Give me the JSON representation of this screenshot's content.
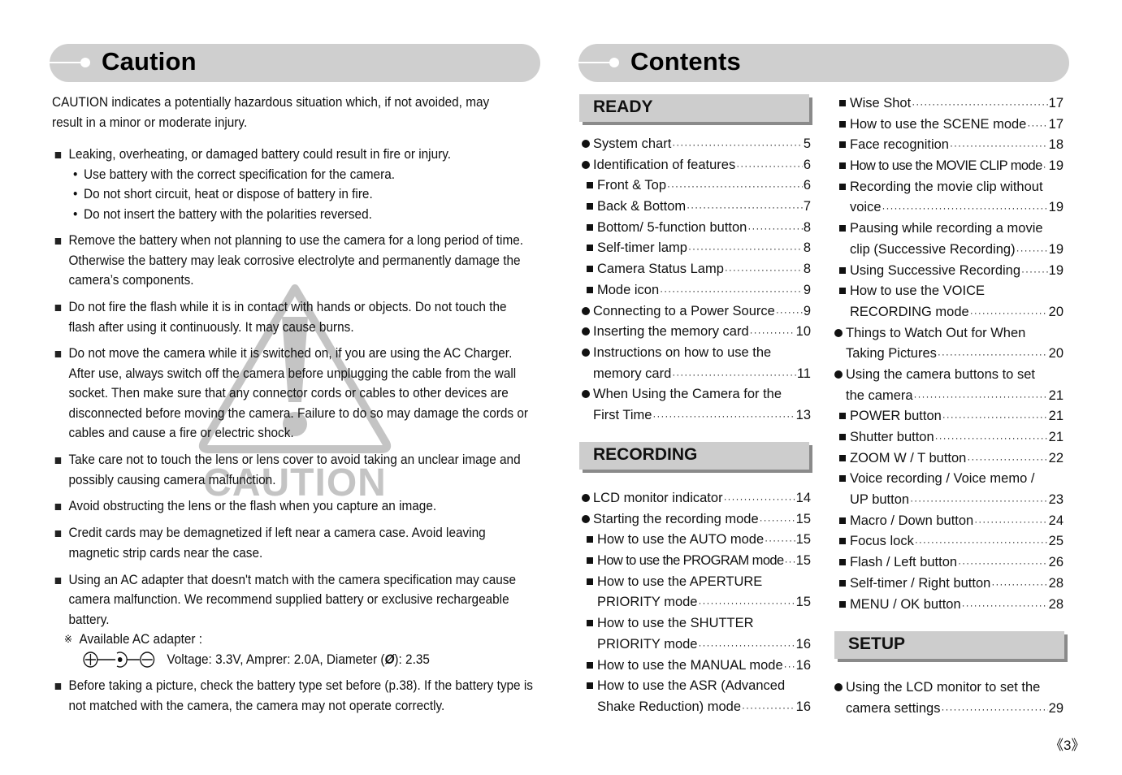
{
  "left_page": {
    "title": "Caution",
    "intro": "CAUTION indicates a potentially hazardous situation which, if not avoided, may result in a minor or moderate injury.",
    "items": [
      {
        "text": "Leaking, overheating, or damaged battery could result in fire or injury.",
        "subitems": [
          "Use battery with the correct specification for the camera.",
          "Do not short circuit, heat or dispose of battery in fire.",
          "Do not insert the battery with the polarities reversed."
        ]
      },
      {
        "text": "Remove the battery when not planning to use the camera for a long period of time. Otherwise the battery may leak corrosive electrolyte and permanently damage the camera’s components."
      },
      {
        "text": "Do not fire the flash while it is in contact with hands or objects. Do not touch the flash after using it continuously. It may cause burns."
      },
      {
        "text": "Do not move the camera while it is switched on, if you are using the AC Charger. After use, always switch off the camera before unplugging the cable from the wall socket. Then make sure that any connector cords or cables to other devices are disconnected before moving the camera. Failure to do so may damage the cords or cables and cause a fire or electric shock."
      },
      {
        "text": "Take care not to touch the lens or lens cover to avoid taking an unclear image and possibly causing camera malfunction."
      },
      {
        "text": "Avoid obstructing the lens or the flash when you capture an image."
      },
      {
        "text": "Credit cards may be demagnetized if left near a camera case. Avoid leaving magnetic strip cards near the case."
      },
      {
        "text": "Using an AC adapter that doesn't match with the camera specification may cause camera malfunction. We recommend supplied battery or exclusive rechargeable battery.",
        "note_mark": "※",
        "note": "Available AC adapter :",
        "adapter_spec": "Voltage: 3.3V, Amprer: 2.0A, Diameter (",
        "diameter_symbol": "Ø",
        "adapter_spec_end": "): 2.35"
      },
      {
        "text": "Before taking a picture, check the battery type set before (p.38). If the battery type is not matched with the camera, the camera may not operate correctly."
      }
    ],
    "watermark_text": "CAUTION",
    "watermark_icon": "warning-triangle-icon"
  },
  "right_page": {
    "title": "Contents",
    "sections": {
      "ready": {
        "label": "READY",
        "entries": [
          {
            "bullet": "circle",
            "lines": [
              "System chart"
            ],
            "page": "5"
          },
          {
            "bullet": "circle",
            "lines": [
              "Identification of features"
            ],
            "page": "6"
          },
          {
            "bullet": "square",
            "lines": [
              "Front & Top"
            ],
            "page": "6"
          },
          {
            "bullet": "square",
            "lines": [
              "Back & Bottom"
            ],
            "page": "7"
          },
          {
            "bullet": "square",
            "lines": [
              "Bottom/ 5-function button"
            ],
            "page": "8"
          },
          {
            "bullet": "square",
            "lines": [
              "Self-timer lamp"
            ],
            "page": "8"
          },
          {
            "bullet": "square",
            "lines": [
              "Camera Status Lamp"
            ],
            "page": "8"
          },
          {
            "bullet": "square",
            "lines": [
              "Mode icon"
            ],
            "page": "9"
          },
          {
            "bullet": "circle",
            "lines": [
              "Connecting to a Power Source"
            ],
            "page": "9"
          },
          {
            "bullet": "circle",
            "lines": [
              "Inserting the memory card"
            ],
            "page": "10"
          },
          {
            "bullet": "circle",
            "lines": [
              "Instructions on how to use the",
              "memory card"
            ],
            "page": "11"
          },
          {
            "bullet": "circle",
            "lines": [
              "When Using the Camera for the",
              "First Time"
            ],
            "page": "13"
          }
        ]
      },
      "recording": {
        "label": "RECORDING",
        "entries": [
          {
            "bullet": "circle",
            "lines": [
              "LCD monitor indicator"
            ],
            "page": "14"
          },
          {
            "bullet": "circle",
            "lines": [
              "Starting the recording mode"
            ],
            "page": "15"
          },
          {
            "bullet": "square",
            "lines": [
              "How to use the AUTO mode"
            ],
            "page": "15"
          },
          {
            "bullet": "square",
            "lines": [
              "How to use the PROGRAM mode"
            ],
            "page": "15"
          },
          {
            "bullet": "square",
            "lines": [
              "How to use the APERTURE",
              "PRIORITY mode"
            ],
            "page": "15"
          },
          {
            "bullet": "square",
            "lines": [
              "How to use the SHUTTER",
              "PRIORITY mode"
            ],
            "page": "16"
          },
          {
            "bullet": "square",
            "lines": [
              "How to use the MANUAL mode"
            ],
            "page": "16"
          },
          {
            "bullet": "square",
            "lines": [
              "How to use the ASR (Advanced",
              "Shake Reduction) mode"
            ],
            "page": "16"
          },
          {
            "bullet": "square",
            "lines": [
              "Wise Shot"
            ],
            "page": "17"
          },
          {
            "bullet": "square",
            "lines": [
              "How to use the SCENE mode"
            ],
            "page": "17"
          },
          {
            "bullet": "square",
            "lines": [
              "Face recognition"
            ],
            "page": "18"
          },
          {
            "bullet": "square",
            "lines": [
              "How to use the MOVIE CLIP mode"
            ],
            "page": "19"
          },
          {
            "bullet": "square",
            "lines": [
              "Recording the movie clip without",
              "voice"
            ],
            "page": "19"
          },
          {
            "bullet": "square",
            "lines": [
              "Pausing while recording a movie",
              "clip (Successive Recording)"
            ],
            "page": "19"
          },
          {
            "bullet": "square",
            "lines": [
              "Using Successive Recording"
            ],
            "page": "19"
          },
          {
            "bullet": "square",
            "lines": [
              "How to use the VOICE",
              "RECORDING mode"
            ],
            "page": "20"
          },
          {
            "bullet": "circle",
            "lines": [
              "Things to Watch Out for When",
              "Taking Pictures"
            ],
            "page": "20"
          },
          {
            "bullet": "circle",
            "lines": [
              "Using the camera buttons to set",
              "the camera"
            ],
            "page": "21"
          },
          {
            "bullet": "square",
            "lines": [
              "POWER button"
            ],
            "page": "21"
          },
          {
            "bullet": "square",
            "lines": [
              "Shutter button"
            ],
            "page": "21"
          },
          {
            "bullet": "square",
            "lines": [
              "ZOOM W / T button"
            ],
            "page": "22"
          },
          {
            "bullet": "square",
            "lines": [
              "Voice recording / Voice memo /",
              "UP button"
            ],
            "page": "23"
          },
          {
            "bullet": "square",
            "lines": [
              "Macro / Down button"
            ],
            "page": "24"
          },
          {
            "bullet": "square",
            "lines": [
              "Focus lock"
            ],
            "page": "25"
          },
          {
            "bullet": "square",
            "lines": [
              "Flash / Left button"
            ],
            "page": "26"
          },
          {
            "bullet": "square",
            "lines": [
              "Self-timer / Right button"
            ],
            "page": "28"
          },
          {
            "bullet": "square",
            "lines": [
              "MENU / OK button"
            ],
            "page": "28"
          }
        ]
      },
      "setup": {
        "label": "SETUP",
        "entries": [
          {
            "bullet": "circle",
            "lines": [
              "Using the LCD monitor to set the",
              "camera settings"
            ],
            "page": "29"
          }
        ]
      }
    },
    "page_number": "《3》"
  },
  "colors": {
    "header_bar": "#cfcfcf",
    "section_bar": "#cdcdcd",
    "section_shadow": "#8a8a8a",
    "watermark": "#c4c4c4",
    "text": "#111111"
  }
}
